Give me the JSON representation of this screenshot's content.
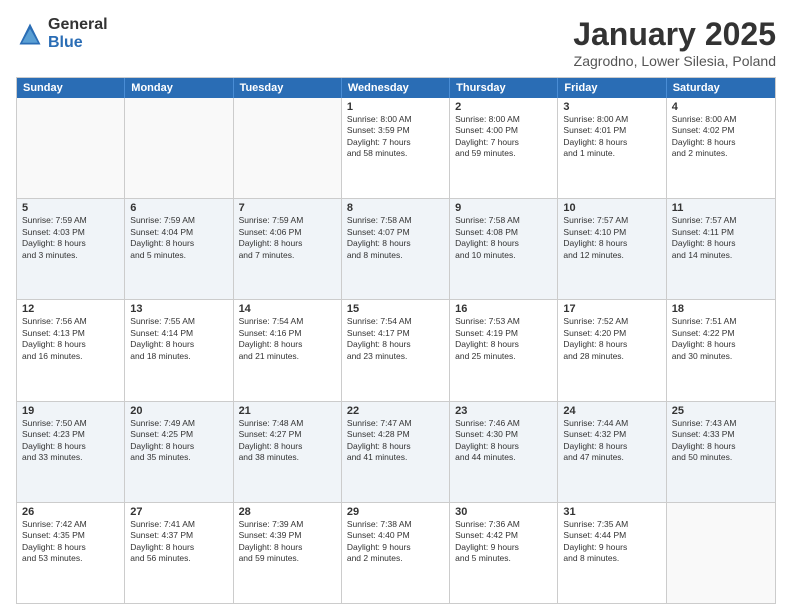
{
  "logo": {
    "general": "General",
    "blue": "Blue"
  },
  "title": "January 2025",
  "subtitle": "Zagrodno, Lower Silesia, Poland",
  "days": [
    "Sunday",
    "Monday",
    "Tuesday",
    "Wednesday",
    "Thursday",
    "Friday",
    "Saturday"
  ],
  "weeks": [
    [
      {
        "day": "",
        "lines": []
      },
      {
        "day": "",
        "lines": []
      },
      {
        "day": "",
        "lines": []
      },
      {
        "day": "1",
        "lines": [
          "Sunrise: 8:00 AM",
          "Sunset: 3:59 PM",
          "Daylight: 7 hours",
          "and 58 minutes."
        ]
      },
      {
        "day": "2",
        "lines": [
          "Sunrise: 8:00 AM",
          "Sunset: 4:00 PM",
          "Daylight: 7 hours",
          "and 59 minutes."
        ]
      },
      {
        "day": "3",
        "lines": [
          "Sunrise: 8:00 AM",
          "Sunset: 4:01 PM",
          "Daylight: 8 hours",
          "and 1 minute."
        ]
      },
      {
        "day": "4",
        "lines": [
          "Sunrise: 8:00 AM",
          "Sunset: 4:02 PM",
          "Daylight: 8 hours",
          "and 2 minutes."
        ]
      }
    ],
    [
      {
        "day": "5",
        "lines": [
          "Sunrise: 7:59 AM",
          "Sunset: 4:03 PM",
          "Daylight: 8 hours",
          "and 3 minutes."
        ]
      },
      {
        "day": "6",
        "lines": [
          "Sunrise: 7:59 AM",
          "Sunset: 4:04 PM",
          "Daylight: 8 hours",
          "and 5 minutes."
        ]
      },
      {
        "day": "7",
        "lines": [
          "Sunrise: 7:59 AM",
          "Sunset: 4:06 PM",
          "Daylight: 8 hours",
          "and 7 minutes."
        ]
      },
      {
        "day": "8",
        "lines": [
          "Sunrise: 7:58 AM",
          "Sunset: 4:07 PM",
          "Daylight: 8 hours",
          "and 8 minutes."
        ]
      },
      {
        "day": "9",
        "lines": [
          "Sunrise: 7:58 AM",
          "Sunset: 4:08 PM",
          "Daylight: 8 hours",
          "and 10 minutes."
        ]
      },
      {
        "day": "10",
        "lines": [
          "Sunrise: 7:57 AM",
          "Sunset: 4:10 PM",
          "Daylight: 8 hours",
          "and 12 minutes."
        ]
      },
      {
        "day": "11",
        "lines": [
          "Sunrise: 7:57 AM",
          "Sunset: 4:11 PM",
          "Daylight: 8 hours",
          "and 14 minutes."
        ]
      }
    ],
    [
      {
        "day": "12",
        "lines": [
          "Sunrise: 7:56 AM",
          "Sunset: 4:13 PM",
          "Daylight: 8 hours",
          "and 16 minutes."
        ]
      },
      {
        "day": "13",
        "lines": [
          "Sunrise: 7:55 AM",
          "Sunset: 4:14 PM",
          "Daylight: 8 hours",
          "and 18 minutes."
        ]
      },
      {
        "day": "14",
        "lines": [
          "Sunrise: 7:54 AM",
          "Sunset: 4:16 PM",
          "Daylight: 8 hours",
          "and 21 minutes."
        ]
      },
      {
        "day": "15",
        "lines": [
          "Sunrise: 7:54 AM",
          "Sunset: 4:17 PM",
          "Daylight: 8 hours",
          "and 23 minutes."
        ]
      },
      {
        "day": "16",
        "lines": [
          "Sunrise: 7:53 AM",
          "Sunset: 4:19 PM",
          "Daylight: 8 hours",
          "and 25 minutes."
        ]
      },
      {
        "day": "17",
        "lines": [
          "Sunrise: 7:52 AM",
          "Sunset: 4:20 PM",
          "Daylight: 8 hours",
          "and 28 minutes."
        ]
      },
      {
        "day": "18",
        "lines": [
          "Sunrise: 7:51 AM",
          "Sunset: 4:22 PM",
          "Daylight: 8 hours",
          "and 30 minutes."
        ]
      }
    ],
    [
      {
        "day": "19",
        "lines": [
          "Sunrise: 7:50 AM",
          "Sunset: 4:23 PM",
          "Daylight: 8 hours",
          "and 33 minutes."
        ]
      },
      {
        "day": "20",
        "lines": [
          "Sunrise: 7:49 AM",
          "Sunset: 4:25 PM",
          "Daylight: 8 hours",
          "and 35 minutes."
        ]
      },
      {
        "day": "21",
        "lines": [
          "Sunrise: 7:48 AM",
          "Sunset: 4:27 PM",
          "Daylight: 8 hours",
          "and 38 minutes."
        ]
      },
      {
        "day": "22",
        "lines": [
          "Sunrise: 7:47 AM",
          "Sunset: 4:28 PM",
          "Daylight: 8 hours",
          "and 41 minutes."
        ]
      },
      {
        "day": "23",
        "lines": [
          "Sunrise: 7:46 AM",
          "Sunset: 4:30 PM",
          "Daylight: 8 hours",
          "and 44 minutes."
        ]
      },
      {
        "day": "24",
        "lines": [
          "Sunrise: 7:44 AM",
          "Sunset: 4:32 PM",
          "Daylight: 8 hours",
          "and 47 minutes."
        ]
      },
      {
        "day": "25",
        "lines": [
          "Sunrise: 7:43 AM",
          "Sunset: 4:33 PM",
          "Daylight: 8 hours",
          "and 50 minutes."
        ]
      }
    ],
    [
      {
        "day": "26",
        "lines": [
          "Sunrise: 7:42 AM",
          "Sunset: 4:35 PM",
          "Daylight: 8 hours",
          "and 53 minutes."
        ]
      },
      {
        "day": "27",
        "lines": [
          "Sunrise: 7:41 AM",
          "Sunset: 4:37 PM",
          "Daylight: 8 hours",
          "and 56 minutes."
        ]
      },
      {
        "day": "28",
        "lines": [
          "Sunrise: 7:39 AM",
          "Sunset: 4:39 PM",
          "Daylight: 8 hours",
          "and 59 minutes."
        ]
      },
      {
        "day": "29",
        "lines": [
          "Sunrise: 7:38 AM",
          "Sunset: 4:40 PM",
          "Daylight: 9 hours",
          "and 2 minutes."
        ]
      },
      {
        "day": "30",
        "lines": [
          "Sunrise: 7:36 AM",
          "Sunset: 4:42 PM",
          "Daylight: 9 hours",
          "and 5 minutes."
        ]
      },
      {
        "day": "31",
        "lines": [
          "Sunrise: 7:35 AM",
          "Sunset: 4:44 PM",
          "Daylight: 9 hours",
          "and 8 minutes."
        ]
      },
      {
        "day": "",
        "lines": []
      }
    ]
  ]
}
